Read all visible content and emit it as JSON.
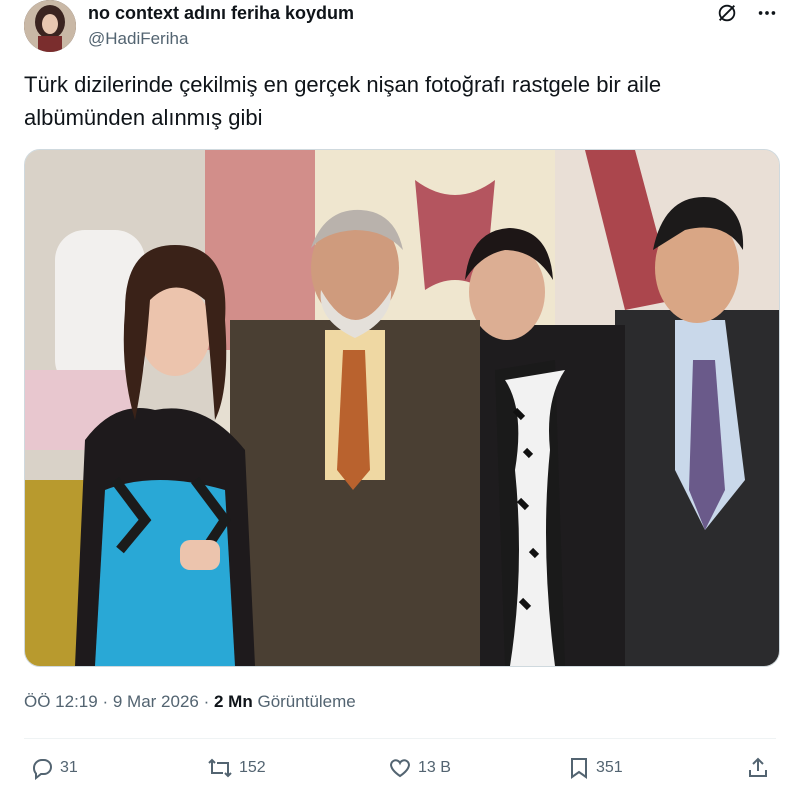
{
  "author": {
    "display_name": "no context adını feriha koydum",
    "handle": "@HadiFeriha"
  },
  "tweet": {
    "text_line1": "Türk dizilerinde çekilmiş en gerçek nişan fotoğrafı rastgele bir aile",
    "text_line2": "albümünden alınmış gibi"
  },
  "meta": {
    "time": "ÖÖ 12:19",
    "sep1": "·",
    "date": "9 Mar 2026",
    "sep2": "·",
    "views_count": "2 Mn",
    "views_label": "Görüntüleme"
  },
  "actions": {
    "replies": "31",
    "reposts": "152",
    "likes": "13 B",
    "bookmarks": "351"
  },
  "icons": {
    "grok": "grok-icon",
    "more": "more-icon",
    "reply": "reply-icon",
    "repost": "repost-icon",
    "like": "like-icon",
    "bookmark": "bookmark-icon",
    "share": "share-icon"
  },
  "colors": {
    "text": "#0f1419",
    "secondary": "#536471",
    "border": "#cfd9de"
  }
}
